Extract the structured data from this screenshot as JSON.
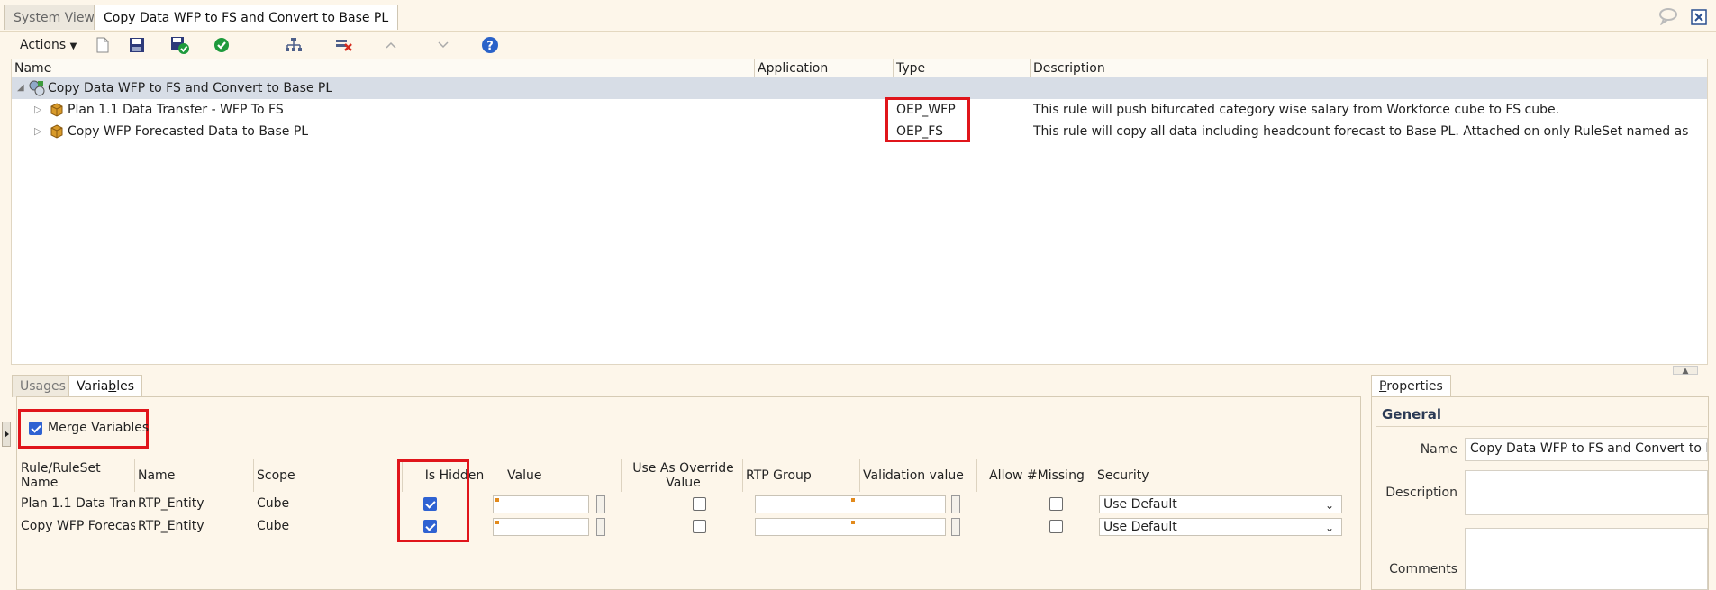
{
  "tabs": {
    "system_view": "System View",
    "active": "Copy Data WFP to FS and Convert to Base PL"
  },
  "toolbar": {
    "actions_prefix": "A",
    "actions_rest": "ctions"
  },
  "grid": {
    "headers": {
      "name": "Name",
      "application": "Application",
      "type": "Type",
      "description": "Description"
    },
    "rows": [
      {
        "name": "Copy Data WFP to FS and Convert to Base PL",
        "application": "",
        "type": "",
        "description": ""
      },
      {
        "name": "Plan 1.1 Data Transfer - WFP To FS",
        "application": "",
        "type": "OEP_WFP",
        "description": "This rule will push bifurcated category wise salary from Workforce cube to FS cube."
      },
      {
        "name": "Copy WFP Forecasted Data to Base PL",
        "application": "",
        "type": "OEP_FS",
        "description": "This rule will copy all data including headcount forecast to Base PL. Attached on only RuleSet named as "
      }
    ]
  },
  "bottom_tabs": {
    "usages": "Usages",
    "variables_a": "Varia",
    "variables_b": "b",
    "variables_c": "les"
  },
  "variables": {
    "merge_label": "Merge Variables",
    "merge_checked": true,
    "headers": {
      "rule": "Rule/RuleSet Name",
      "name": "Name",
      "scope": "Scope",
      "is_hidden": "Is Hidden",
      "value": "Value",
      "override": "Use As Override Value",
      "rtp_group": "RTP Group",
      "validation": "Validation value",
      "allow_missing": "Allow #Missing",
      "security": "Security"
    },
    "rows": [
      {
        "rule": "Plan 1.1 Data Tran...",
        "name": "RTP_Entity",
        "scope": "Cube",
        "is_hidden": true,
        "override": false,
        "allow_missing": false,
        "security": "Use Default"
      },
      {
        "rule": "Copy WFP Forecas...",
        "name": "RTP_Entity",
        "scope": "Cube",
        "is_hidden": true,
        "override": false,
        "allow_missing": false,
        "security": "Use Default"
      }
    ]
  },
  "properties": {
    "tab_u": "P",
    "tab_rest": "roperties",
    "section": "General",
    "name_label": "Name",
    "name_value": "Copy Data WFP to FS and Convert to Base",
    "description_label": "Description",
    "comments_label": "Comments"
  },
  "colors": {
    "highlight": "#e0151b",
    "selected_row": "#d7dde6",
    "checkbox": "#2f62d2",
    "background": "#fdf6ea"
  },
  "icons": [
    "new-icon",
    "save-icon",
    "save-as-icon",
    "validate-icon",
    "deploy-icon",
    "remove-icon",
    "move-up-icon",
    "move-down-icon",
    "help-icon",
    "close-tab-icon",
    "message-icon",
    "ruleset-icon",
    "rule-icon",
    "expand-icon",
    "collapse-icon"
  ]
}
